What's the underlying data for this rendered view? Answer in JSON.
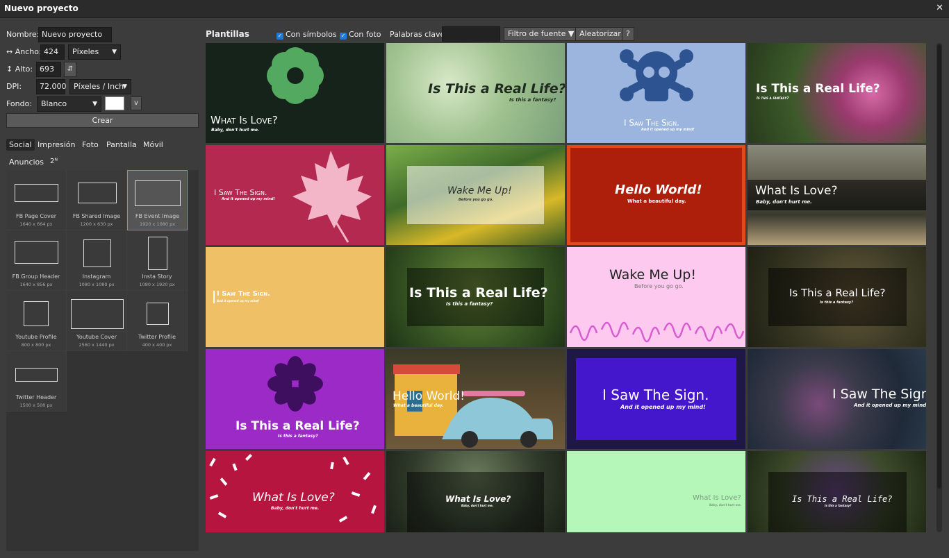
{
  "window": {
    "title": "Nuevo proyecto",
    "close_glyph": "✕"
  },
  "form": {
    "name_label": "Nombre:",
    "name_value": "Nuevo proyecto",
    "width_label": "↔ Ancho:",
    "width_value": "424",
    "unit_value": "Píxeles",
    "height_label": "↕ Alto:",
    "height_value": "693",
    "swap_glyph": "⇵",
    "dpi_label": "DPI:",
    "dpi_value": "72.000",
    "dpi_unit_value": "Píxeles / Inch",
    "background_label": "Fondo:",
    "background_value": "Blanco",
    "background_color": "#ffffff",
    "color_dropdown_glyph": "v",
    "create_label": "Crear"
  },
  "categories": {
    "tabs": [
      {
        "label": "Social",
        "active": true
      },
      {
        "label": "Impresión",
        "active": false
      },
      {
        "label": "Foto",
        "active": false
      },
      {
        "label": "Pantalla",
        "active": false
      },
      {
        "label": "Móvil",
        "active": false
      },
      {
        "label": "Anuncios",
        "active": false
      },
      {
        "label": "2ᴺ",
        "active": false
      }
    ]
  },
  "presets": [
    {
      "name": "FB Page Cover",
      "size": "1640 x 664 px"
    },
    {
      "name": "FB Shared Image",
      "size": "1200 x 630 px"
    },
    {
      "name": "FB Event Image",
      "size": "1920 x 1080 px",
      "selected": true
    },
    {
      "name": "FB Group Header",
      "size": "1640 x 856 px"
    },
    {
      "name": "Instagram",
      "size": "1080 x 1080 px"
    },
    {
      "name": "Insta Story",
      "size": "1080 x 1920 px"
    },
    {
      "name": "Youtube Profile",
      "size": "800 x 800 px"
    },
    {
      "name": "Youtube Cover",
      "size": "2560 x 1440 px"
    },
    {
      "name": "Twitter Profile",
      "size": "400 x 400 px"
    },
    {
      "name": "Twitter Header",
      "size": "1500 x 500 px"
    }
  ],
  "templates_panel": {
    "title": "Plantillas",
    "with_symbols_label": "Con símbolos",
    "with_photo_label": "Con foto",
    "keywords_label": "Palabras clave:",
    "keywords_value": "",
    "font_filter_label": "Filtro de fuente ▼",
    "random_label": "Aleatorizar",
    "help_label": "?"
  },
  "templates": [
    {
      "title": "What Is Love?",
      "subtitle": "Baby, don't hurt me.",
      "bg": "#15231a"
    },
    {
      "title": "Is This a Real Life?",
      "subtitle": "Is this a fantasy?",
      "bg": "#a9c79a"
    },
    {
      "title": "I Saw The Sign.",
      "subtitle": "And it opened up my mind!",
      "bg": "#9bb5de"
    },
    {
      "title": "Is This a Real Life?",
      "subtitle": "Is this a fantasy?",
      "bg": "#3c5a2a"
    },
    {
      "title": "I Saw The Sign.",
      "subtitle": "And it opened up my mind!",
      "bg": "#b4294f"
    },
    {
      "title": "Wake Me Up!",
      "subtitle": "Before you go go.",
      "bg": "#3f6b2a"
    },
    {
      "title": "Hello World!",
      "subtitle": "What a beautiful day.",
      "bg": "#ad1f0b"
    },
    {
      "title": "What Is Love?",
      "subtitle": "Baby, don't hurt me.",
      "bg": "#5b5a4a"
    },
    {
      "title": "I Saw The Sign.",
      "subtitle": "And it opened up my mind!",
      "bg": "#efc066"
    },
    {
      "title": "Is This a Real Life?",
      "subtitle": "Is this a fantasy?",
      "bg": "#3a5a25"
    },
    {
      "title": "Wake Me Up!",
      "subtitle": "Before you go go.",
      "bg": "#fdc9ee"
    },
    {
      "title": "Is This a Real Life?",
      "subtitle": "Is this a fantasy?",
      "bg": "#3b3a25"
    },
    {
      "title": "Is This a Real Life?",
      "subtitle": "Is this a fantasy?",
      "bg": "#9b2ac6"
    },
    {
      "title": "Hello World!",
      "subtitle": "What a beautiful day.",
      "bg": "#5a4a30"
    },
    {
      "title": "I Saw The Sign.",
      "subtitle": "And it opened up my mind!",
      "bg": "#1f1745"
    },
    {
      "title": "I Saw The Sign.",
      "subtitle": "And it opened up my mind!",
      "bg": "#1f2a38"
    },
    {
      "title": "What Is Love?",
      "subtitle": "Baby, don't hurt me.",
      "bg": "#b5153f"
    },
    {
      "title": "What Is Love?",
      "subtitle": "Baby, don't hurt me.",
      "bg": "#2f3a2a"
    },
    {
      "title": "What Is Love?",
      "subtitle": "Baby, don't hurt me.",
      "bg": "#b5f7b9"
    },
    {
      "title": "Is This a Real Life?",
      "subtitle": "Is this a fantasy?",
      "bg": "#3c4a2a"
    }
  ]
}
